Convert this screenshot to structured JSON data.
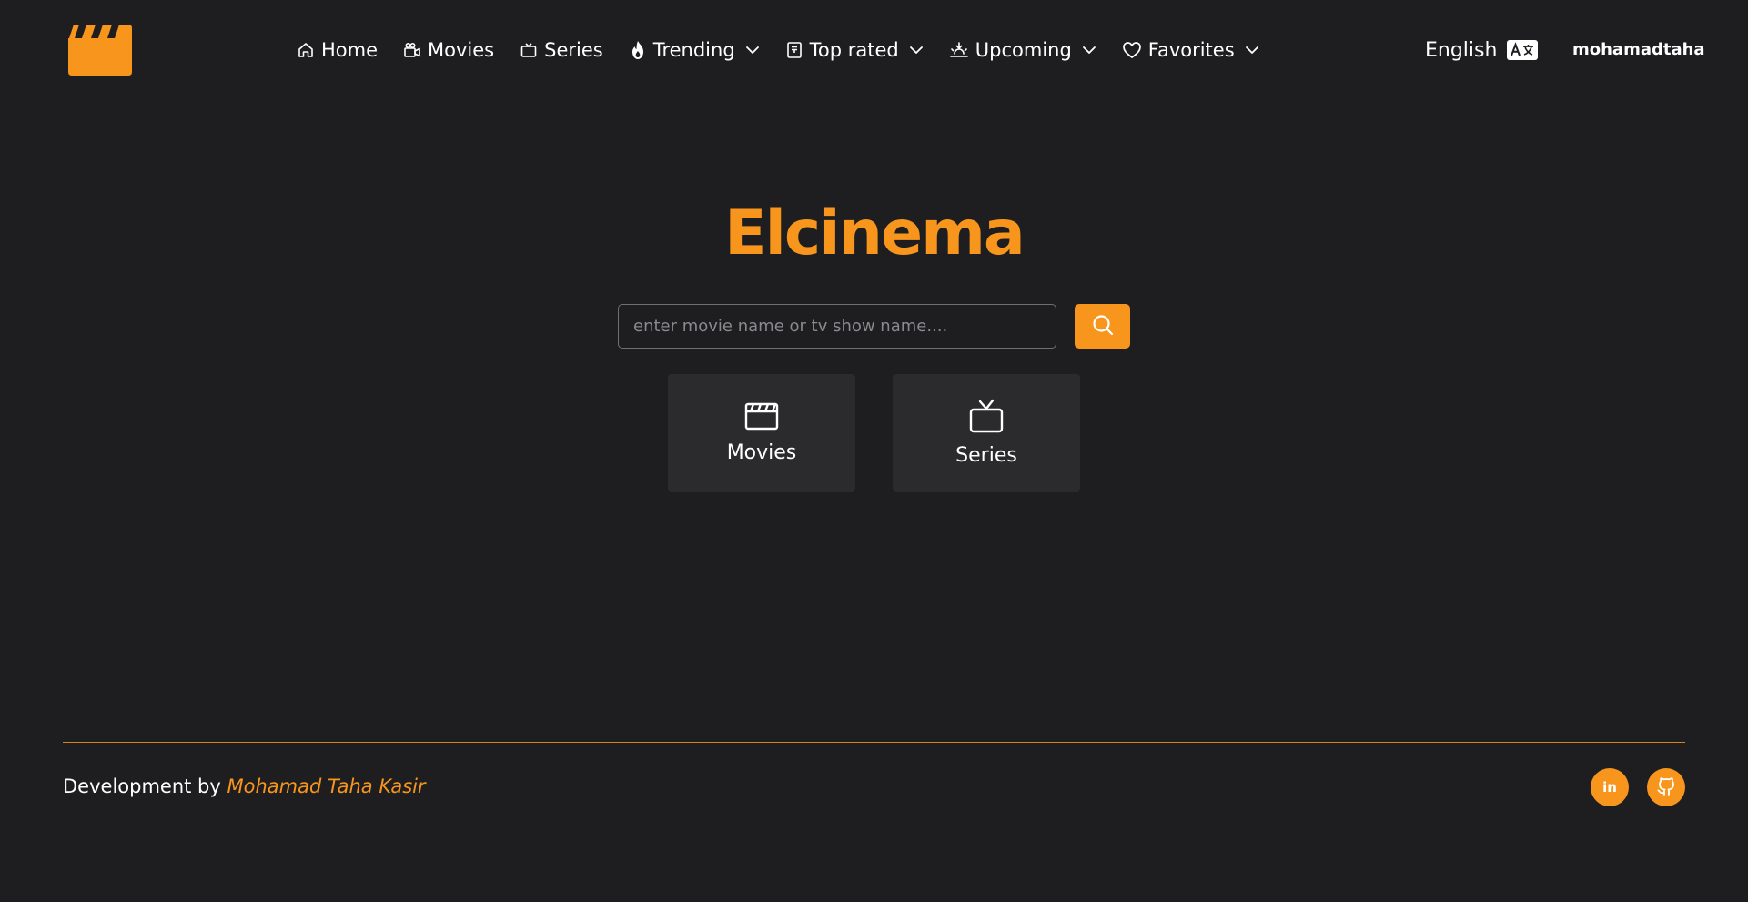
{
  "header": {
    "logo_icon": "clapperboard-icon",
    "nav": [
      {
        "label": "Home",
        "icon": "home-icon",
        "dropdown": false
      },
      {
        "label": "Movies",
        "icon": "video-camera-icon",
        "dropdown": false
      },
      {
        "label": "Series",
        "icon": "tv-icon",
        "dropdown": false
      },
      {
        "label": "Trending",
        "icon": "flame-icon",
        "dropdown": true
      },
      {
        "label": "Top rated",
        "icon": "rating-card-icon",
        "dropdown": true
      },
      {
        "label": "Upcoming",
        "icon": "sunrise-icon",
        "dropdown": true
      },
      {
        "label": "Favorites",
        "icon": "heart-icon",
        "dropdown": true
      }
    ],
    "language": {
      "label": "English",
      "icon": "translate-icon"
    },
    "username": "mohamadtaha"
  },
  "hero": {
    "brand": "Elcinema",
    "search": {
      "placeholder": "enter movie name or tv show name....",
      "value": ""
    },
    "cards": [
      {
        "label": "Movies",
        "icon": "clapperboard-icon"
      },
      {
        "label": "Series",
        "icon": "tv-icon"
      }
    ]
  },
  "footer": {
    "credit_prefix": "Development by",
    "credit_name": "Mohamad Taha Kasir",
    "social": [
      "linkedin-icon",
      "github-icon"
    ],
    "social_linkedin_text": "in"
  },
  "colors": {
    "accent": "#f7951d",
    "background": "#1e1e20",
    "card": "#2b2b2d",
    "text": "#ffffff"
  }
}
